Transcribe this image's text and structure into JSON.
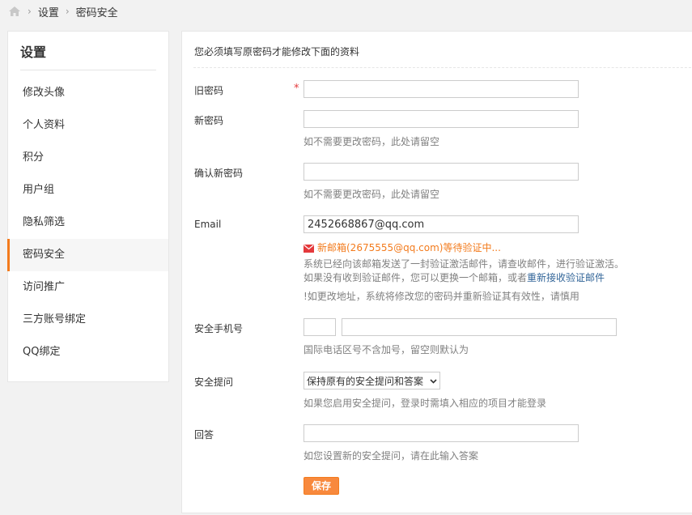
{
  "breadcrumb": {
    "home_icon": "home-icon",
    "items": [
      "设置",
      "密码安全"
    ],
    "separator": "›"
  },
  "sidebar": {
    "title": "设置",
    "items": [
      {
        "label": "修改头像",
        "active": false
      },
      {
        "label": "个人资料",
        "active": false
      },
      {
        "label": "积分",
        "active": false
      },
      {
        "label": "用户组",
        "active": false
      },
      {
        "label": "隐私筛选",
        "active": false
      },
      {
        "label": "密码安全",
        "active": true
      },
      {
        "label": "访问推广",
        "active": false
      },
      {
        "label": "三方账号绑定",
        "active": false
      },
      {
        "label": "QQ绑定",
        "active": false
      }
    ],
    "active_color": "#f37b1d"
  },
  "form": {
    "notice": "您必须填写原密码才能修改下面的资料",
    "old_password": {
      "label": "旧密码",
      "required_mark": "*",
      "value": ""
    },
    "new_password": {
      "label": "新密码",
      "value": "",
      "hint": "如不需要更改密码，此处请留空"
    },
    "confirm_password": {
      "label": "确认新密码",
      "value": "",
      "hint": "如不需要更改密码，此处请留空"
    },
    "email": {
      "label": "Email",
      "value": "2452668867@qq.com",
      "pending_icon": "mail-icon",
      "pending": "新邮箱(2675555@qq.com)等待验证中...",
      "info1": "系统已经向该邮箱发送了一封验证激活邮件，请查收邮件，进行验证激活。",
      "info2_prefix": "如果没有收到验证邮件，您可以更换一个邮箱，或者",
      "info2_link": "重新接收验证邮件",
      "info3": "!如更改地址，系统将修改您的密码并重新验证其有效性，请慎用"
    },
    "phone": {
      "label": "安全手机号",
      "country_code": "",
      "number": "",
      "hint": "国际电话区号不含加号，留空则默认为"
    },
    "security_question": {
      "label": "安全提问",
      "selected": "保持原有的安全提问和答案",
      "hint": "如果您启用安全提问，登录时需填入相应的项目才能登录"
    },
    "answer": {
      "label": "回答",
      "value": "",
      "hint": "如您设置新的安全提问，请在此输入答案"
    },
    "save_label": "保存"
  },
  "colors": {
    "accent": "#f37b1d",
    "link": "#336699",
    "required": "#e4393c"
  }
}
